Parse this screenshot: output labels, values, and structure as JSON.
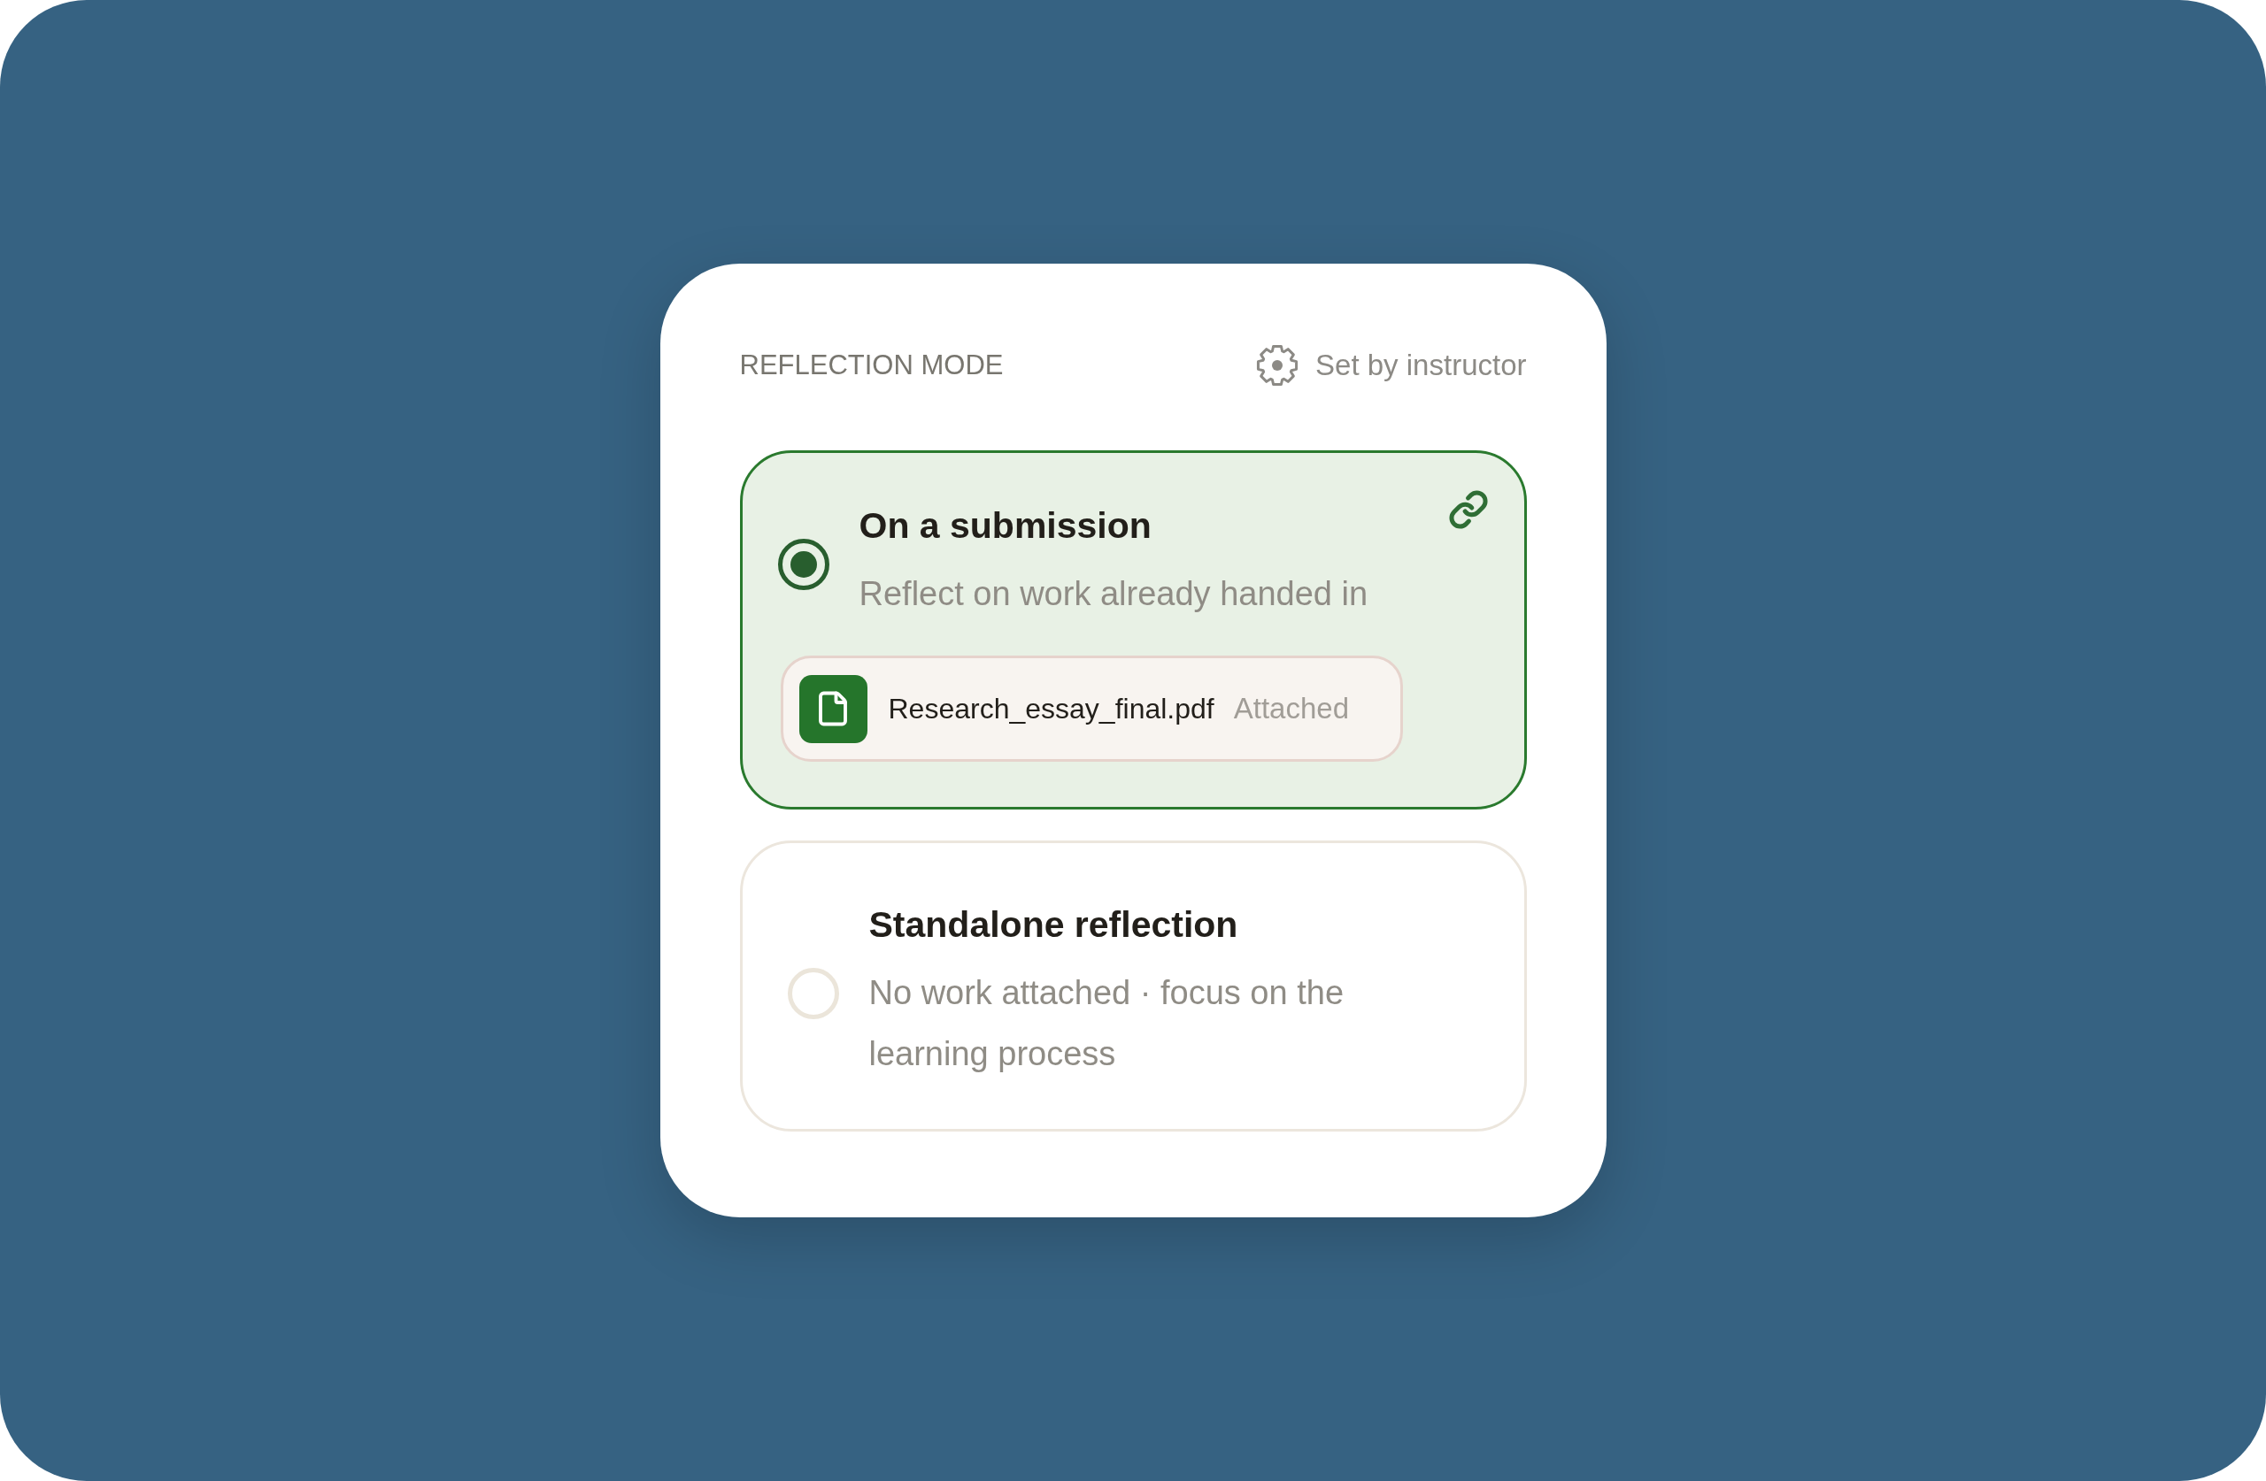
{
  "header": {
    "title": "REFLECTION MODE",
    "note": "Set by instructor"
  },
  "options": [
    {
      "kind": "submission",
      "title": "On a submission",
      "description": "Reflect on work already handed in",
      "selected": true,
      "attachment": {
        "file_name": "Research_essay_final.pdf",
        "status": "Attached"
      }
    },
    {
      "kind": "standalone",
      "title": "Standalone reflection",
      "description": "No work attached · focus on the learning process",
      "selected": false
    }
  ]
}
